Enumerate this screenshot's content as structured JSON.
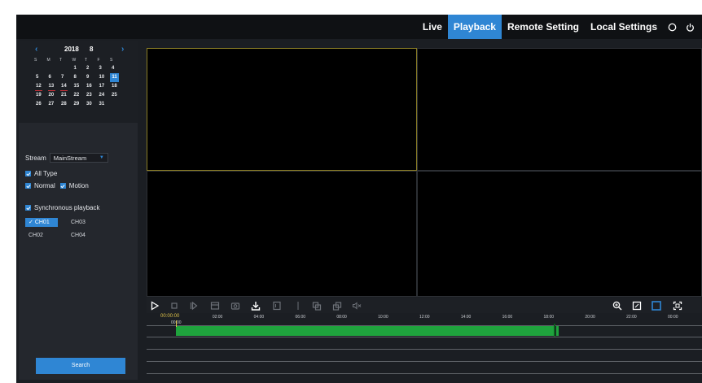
{
  "nav": {
    "live": "Live",
    "playback": "Playback",
    "remote_setting": "Remote Setting",
    "local_settings": "Local Settings",
    "icons": [
      "info-circle-icon",
      "power-icon"
    ]
  },
  "calendar": {
    "year": "2018",
    "month": "8",
    "weekdays": [
      "S",
      "M",
      "T",
      "W",
      "T",
      "F",
      "S"
    ],
    "selected_day": "11",
    "days_with_records": [
      "12",
      "13",
      "14"
    ],
    "weeks": [
      [
        "",
        "",
        "",
        "1",
        "2",
        "3",
        "4"
      ],
      [
        "5",
        "6",
        "7",
        "8",
        "9",
        "10",
        "11"
      ],
      [
        "12",
        "13",
        "14",
        "15",
        "16",
        "17",
        "18"
      ],
      [
        "19",
        "20",
        "21",
        "22",
        "23",
        "24",
        "25"
      ],
      [
        "26",
        "27",
        "28",
        "29",
        "30",
        "31",
        ""
      ]
    ]
  },
  "stream": {
    "label": "Stream",
    "value": "MainStream"
  },
  "filters": {
    "all_type": "All Type",
    "normal": "Normal",
    "motion": "Motion",
    "synchronous": "Synchronous playback"
  },
  "channels": [
    {
      "label": "CH01",
      "checked": true
    },
    {
      "label": "CH03",
      "checked": false
    },
    {
      "label": "CH02",
      "checked": false
    },
    {
      "label": "CH04",
      "checked": false
    }
  ],
  "search_label": "Search",
  "timeline": {
    "current_time": "00:00:00",
    "ticks": [
      "00:00",
      "02:00",
      "04:00",
      "06:00",
      "08:00",
      "10:00",
      "12:00",
      "14:00",
      "16:00",
      "18:00",
      "20:00",
      "22:00",
      "00:00"
    ]
  },
  "colors": {
    "accent": "#2f86d4",
    "record": "#1fa33d",
    "selected_tile_border": "#8a7d25"
  }
}
